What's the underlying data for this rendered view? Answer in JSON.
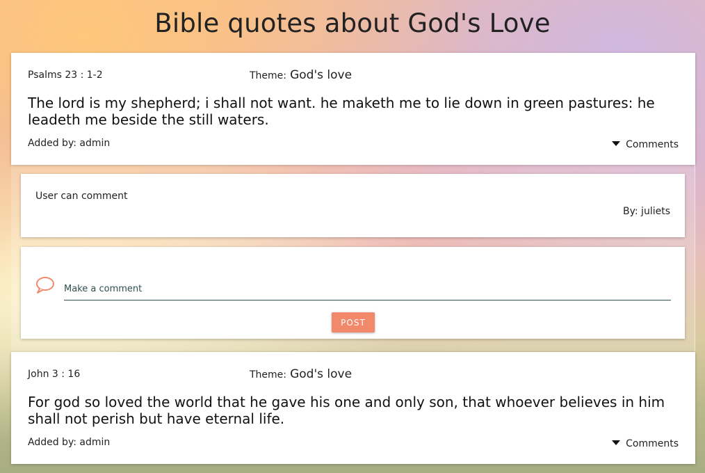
{
  "page": {
    "title": "Bible quotes about God's Love"
  },
  "quotes": [
    {
      "reference": "Psalms 23 : 1-2",
      "theme_label": "Theme:",
      "theme_value": "God's love",
      "text": "The lord is my shepherd; i shall not want. he maketh me to lie down in green pastures: he leadeth me beside the still waters.",
      "added_by": "Added by: admin",
      "comments_label": "Comments"
    },
    {
      "reference": "John 3 : 16",
      "theme_label": "Theme:",
      "theme_value": "God's love",
      "text": "For god so loved the world that he gave his one and only son, that whoever believes in him shall not perish but have eternal life.",
      "added_by": "Added by: admin",
      "comments_label": "Comments"
    }
  ],
  "comments": [
    {
      "text": "User can comment",
      "by": "By: juliets"
    }
  ],
  "comment_form": {
    "placeholder": "Make a comment",
    "value": "",
    "post_label": "POST",
    "icon": "speech-bubble-icon"
  },
  "colors": {
    "accent": "#f2896b",
    "input_line": "#2f4f4f"
  }
}
